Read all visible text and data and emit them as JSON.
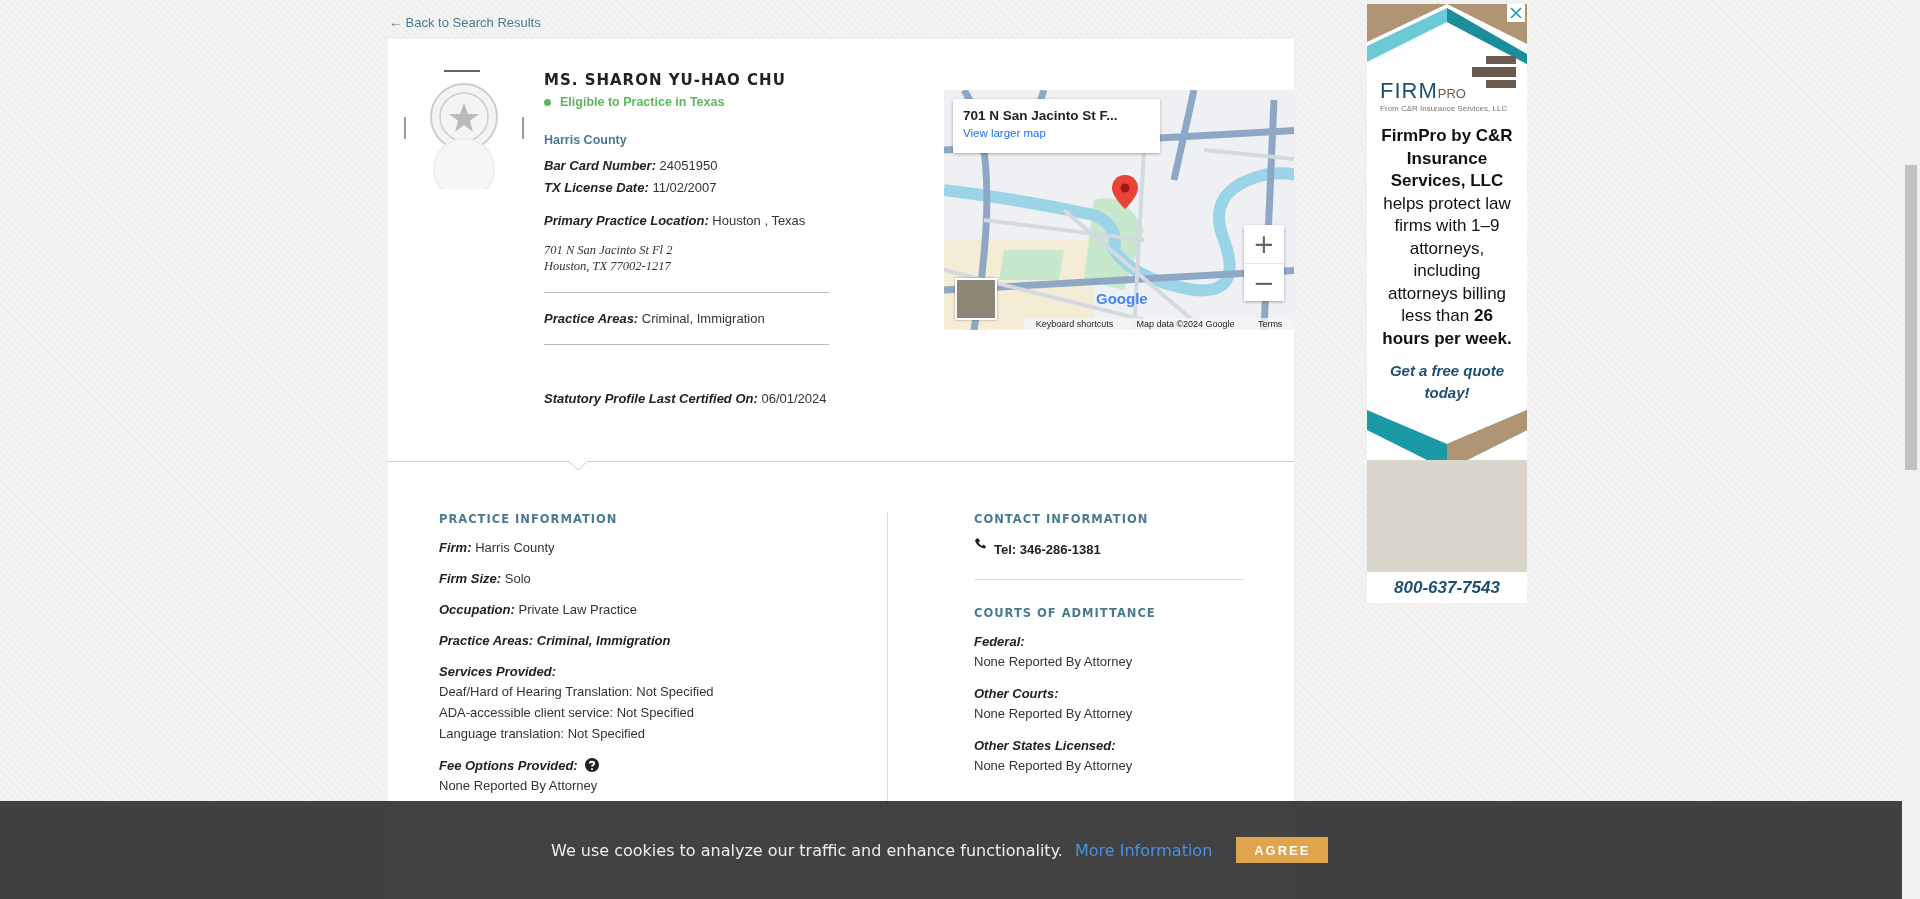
{
  "back_link": "← Back to Search Results",
  "profile": {
    "name": "MS. SHARON YU-HAO CHU",
    "status": {
      "label": "Eligible to Practice in Texas",
      "eligible": true
    },
    "county": "Harris County",
    "license_fields": [
      {
        "label": "Bar Card Number:",
        "value": "24051950"
      },
      {
        "label": "TX License Date:",
        "value": "11/02/2007"
      }
    ],
    "location": {
      "label": "Primary Practice Location:",
      "value": "Houston , Texas"
    },
    "address": [
      "701 N San Jacinto St Fl 2",
      "Houston, TX 77002-1217"
    ],
    "practice_areas": {
      "label": "Practice Areas:",
      "value": "Criminal, Immigration"
    },
    "certified": {
      "label": "Statutory Profile Last Certified On:",
      "value": "06/01/2024"
    }
  },
  "map": {
    "place_title": "701 N San Jacinto St F...",
    "larger_map_link": "View larger map",
    "zoom_in": "+",
    "zoom_out": "−",
    "logo": "Google",
    "attribution": [
      "Keyboard shortcuts",
      "Map data ©2024 Google",
      "Terms"
    ]
  },
  "practice_information": {
    "heading": "PRACTICE INFORMATION",
    "items": [
      {
        "kind": "inline",
        "label": "Firm:",
        "value": "Harris County"
      },
      {
        "kind": "inline",
        "label": "Firm Size:",
        "value": "Solo"
      },
      {
        "kind": "inline",
        "label": "Occupation:",
        "value": "Private Law Practice"
      },
      {
        "kind": "emphasis",
        "label": "Practice Areas:",
        "value": "Criminal, Immigration"
      },
      {
        "kind": "list",
        "label": "Services Provided:",
        "lines": [
          "Deaf/Hard of Hearing Translation: Not Specified",
          "ADA-accessible client service: Not Specified",
          "Language translation: Not Specified"
        ]
      },
      {
        "kind": "help",
        "label": "Fee Options Provided:",
        "lines": [
          "None Reported By Attorney"
        ]
      }
    ]
  },
  "contact_information": {
    "heading": "CONTACT INFORMATION",
    "phone": "Tel: 346-286-1381"
  },
  "courts_of_admittance": {
    "heading": "COURTS OF ADMITTANCE",
    "items": [
      {
        "label": "Federal:",
        "value": "None Reported By Attorney"
      },
      {
        "label": "Other Courts:",
        "value": "None Reported By Attorney"
      },
      {
        "label": "Other States Licensed:",
        "value": "None Reported By Attorney"
      }
    ]
  },
  "ad": {
    "logo_words": [
      "FIRM",
      "PRO"
    ],
    "logo_tagline": "From C&R Insurance Services, LLC",
    "body": "**FirmPro by C&R Insurance Services, LLC** helps protect law firms with 1–9 attorneys, including attorneys billing less than **26 hours per week.**",
    "cta": "Get a free quote today!",
    "phone": "800-637-7543"
  },
  "cookie_bar": {
    "message": "We use cookies to analyze our traffic and enhance functionality.",
    "link": "More Information",
    "button": "AGREE"
  }
}
